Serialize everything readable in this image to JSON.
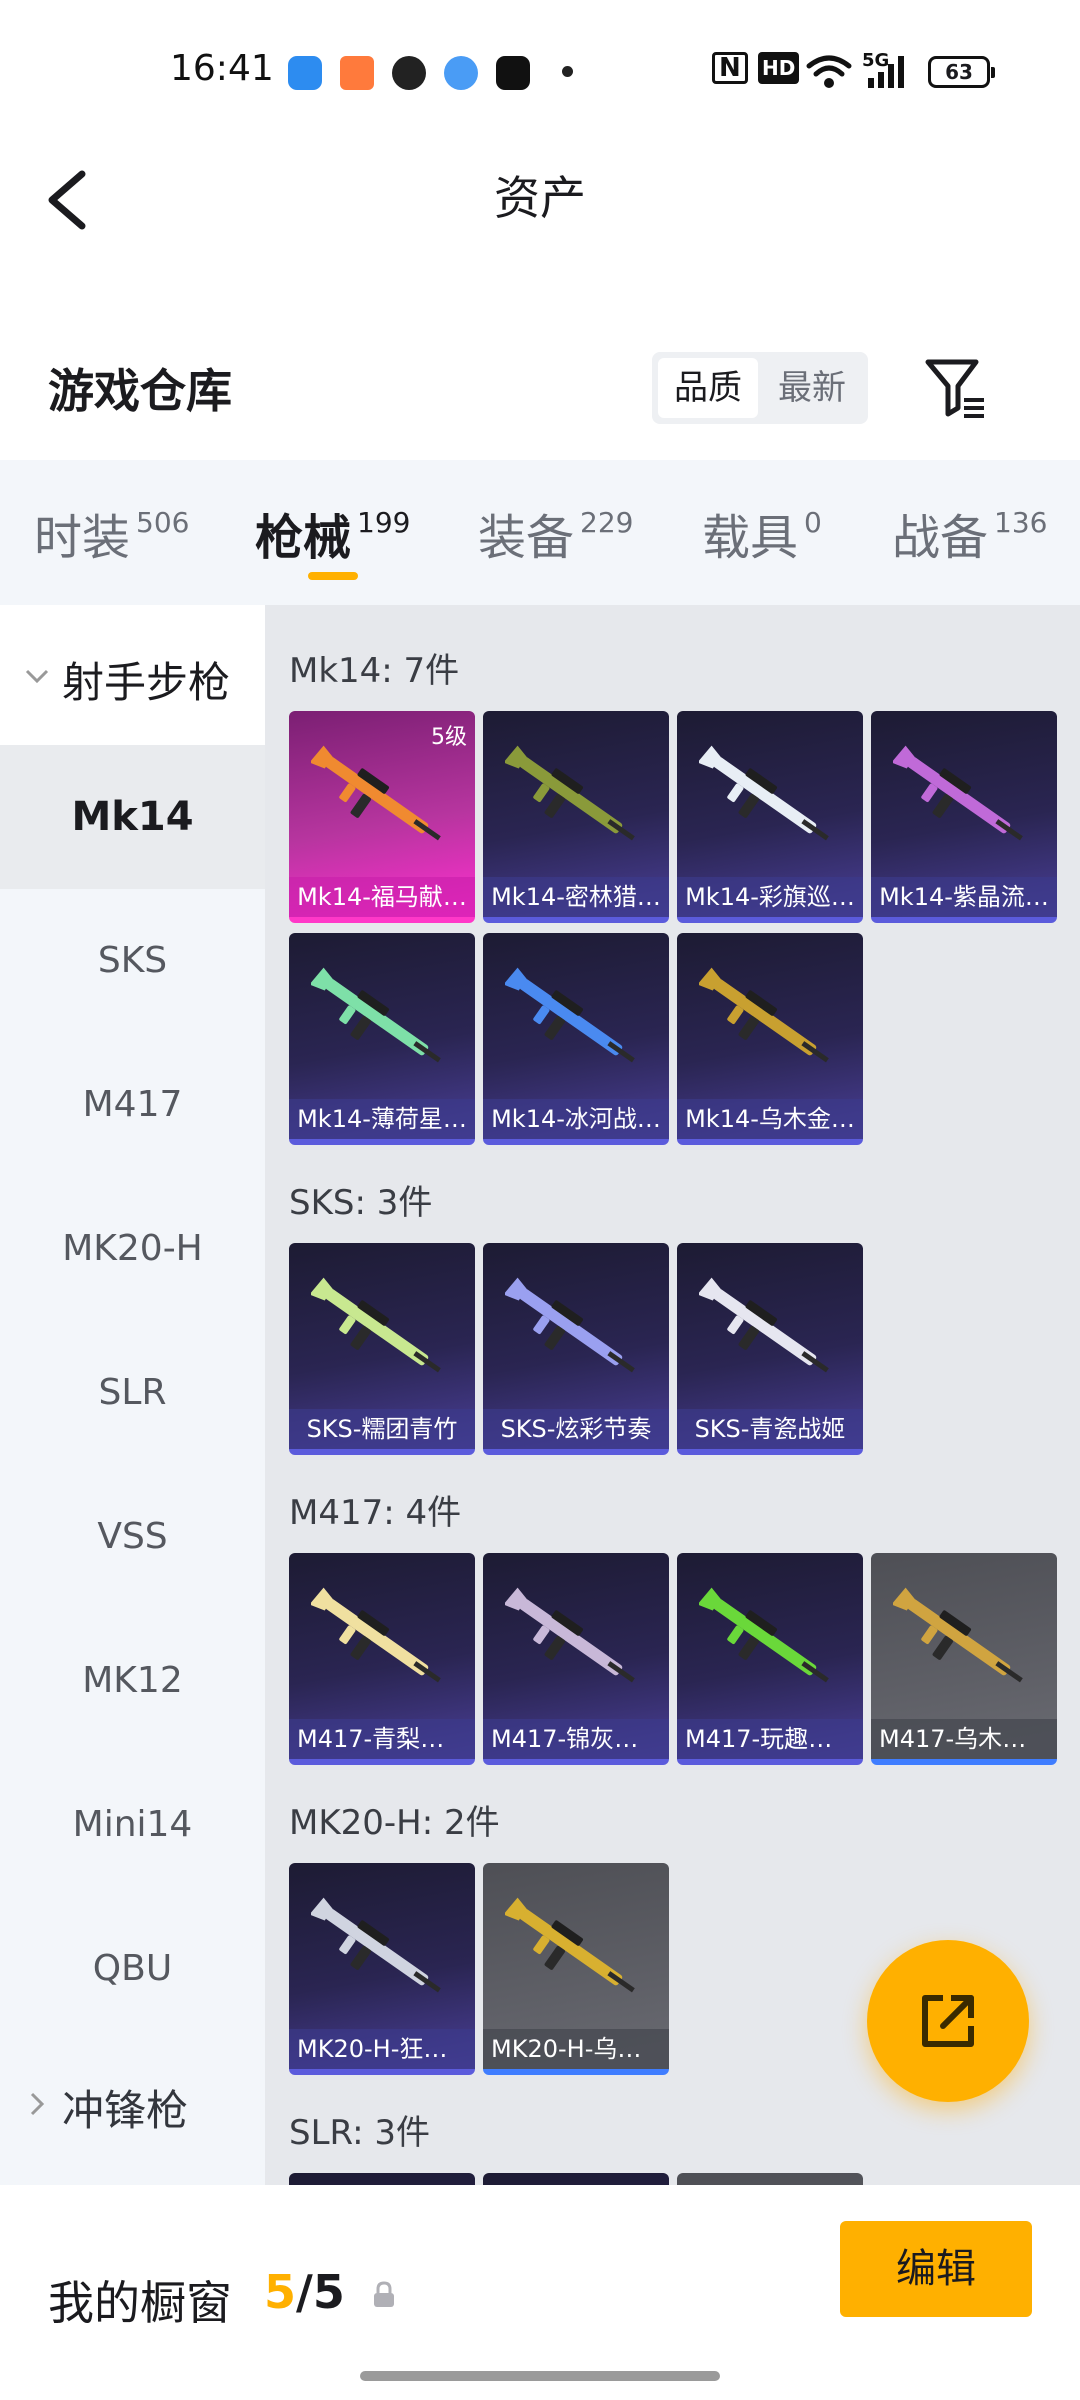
{
  "status_bar": {
    "time": "16:41",
    "nfc": "N",
    "hd": "HD",
    "network": "5G",
    "battery": "63"
  },
  "header": {
    "title": "资产",
    "back_icon": "chevron-left-icon"
  },
  "warehouse": {
    "title": "游戏仓库",
    "sort_options": [
      "品质",
      "最新"
    ],
    "sort_active": "品质",
    "filter_icon": "filter-icon"
  },
  "tabs": [
    {
      "label": "时装",
      "count": "506"
    },
    {
      "label": "枪械",
      "count": "199",
      "active": true
    },
    {
      "label": "装备",
      "count": "229"
    },
    {
      "label": "载具",
      "count": "0"
    },
    {
      "label": "战备",
      "count": "136"
    }
  ],
  "sidebar": {
    "group1": "射手步枪",
    "items": [
      "Mk14",
      "SKS",
      "M417",
      "MK20-H",
      "SLR",
      "VSS",
      "MK12",
      "Mini14",
      "QBU"
    ],
    "active_item": "Mk14",
    "group2": "冲锋枪"
  },
  "sections": [
    {
      "title": "Mk14: 7件",
      "cards": [
        {
          "label": "Mk14-福马献…",
          "level": "5级",
          "style": "gold",
          "tint": "#f08a30"
        },
        {
          "label": "Mk14-密林猎…",
          "style": "purple",
          "tint": "#8a9a3a"
        },
        {
          "label": "Mk14-彩旗巡…",
          "style": "purple",
          "tint": "#e8eef5"
        },
        {
          "label": "Mk14-紫晶流…",
          "style": "purple",
          "tint": "#c06ad8"
        },
        {
          "label": "Mk14-薄荷星…",
          "style": "purple",
          "tint": "#7ee0a8"
        },
        {
          "label": "Mk14-冰河战…",
          "style": "purple",
          "tint": "#4a8af0"
        },
        {
          "label": "Mk14-乌木金…",
          "style": "purple",
          "tint": "#c8a030"
        }
      ]
    },
    {
      "title": "SKS: 3件",
      "cards": [
        {
          "label": "SKS-糯团青竹",
          "style": "purple",
          "tint": "#c8e890"
        },
        {
          "label": "SKS-炫彩节奏",
          "style": "purple",
          "tint": "#9aa0f0"
        },
        {
          "label": "SKS-青瓷战姬",
          "style": "purple",
          "tint": "#e6e6f0"
        }
      ]
    },
    {
      "title": "M417: 4件",
      "cards": [
        {
          "label": "M417-青梨手…",
          "style": "purple",
          "tint": "#f0e0a0"
        },
        {
          "label": "M417-锦灰蝶…",
          "style": "purple",
          "tint": "#c8b8d8"
        },
        {
          "label": "M417-玩趣呆…",
          "style": "purple",
          "tint": "#6ad83a"
        },
        {
          "label": "M417-乌木金…",
          "style": "gray",
          "tint": "#d0a440"
        }
      ]
    },
    {
      "title": "MK20-H: 2件",
      "cards": [
        {
          "label": "MK20-H-狂鲨…",
          "style": "purple",
          "tint": "#d0d4e0"
        },
        {
          "label": "MK20-H-乌木…",
          "style": "gray",
          "tint": "#d8b030"
        }
      ]
    },
    {
      "title": "SLR: 3件",
      "cards": [
        {
          "label": "",
          "style": "purple",
          "tint": "#999"
        },
        {
          "label": "",
          "style": "purple",
          "tint": "#999"
        },
        {
          "label": "",
          "style": "gray",
          "tint": "#999"
        }
      ]
    }
  ],
  "fab": {
    "icon": "share-icon"
  },
  "bottom_bar": {
    "label": "我的橱窗",
    "current": "5",
    "total": "/5",
    "lock_icon": "lock-icon",
    "edit_label": "编辑"
  },
  "colors": {
    "accent": "#ffb000",
    "card_purple": "#2a2552",
    "card_gold": "#b7359f"
  }
}
